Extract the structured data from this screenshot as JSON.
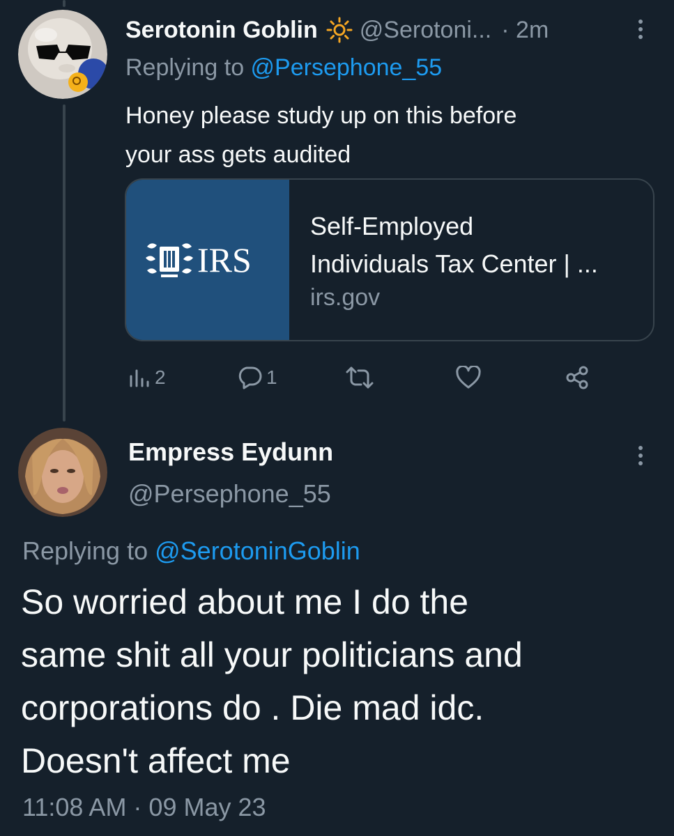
{
  "reply_tweet": {
    "display_name": "Serotonin Goblin",
    "badge_icon": "sun-icon",
    "handle": "@Serotoni...",
    "separator": "·",
    "time": "2m",
    "replying_prefix": "Replying to ",
    "replying_mention": "@Persephone_55",
    "text": "Honey please study up on this before\nyour ass gets audited",
    "link_card": {
      "thumbnail_text": "IRS",
      "title": "Self-Employed\nIndividuals Tax Center | ...",
      "domain": "irs.gov"
    },
    "actions": {
      "views_icon": "bar-chart-icon",
      "views_count": "2",
      "reply_icon": "comment-icon",
      "reply_count": "1",
      "retweet_icon": "retweet-icon",
      "like_icon": "heart-icon",
      "share_icon": "share-icon"
    }
  },
  "main_tweet": {
    "display_name": "Empress Eydunn",
    "handle": "@Persephone_55",
    "replying_prefix": "Replying to ",
    "replying_mention": "@SerotoninGoblin",
    "text": "So worried about me I do the\nsame shit all your politicians and\ncorporations do . Die mad idc.\nDoesn't affect me",
    "timestamp": "11:08 AM · 09 May 23"
  },
  "colors": {
    "background": "#15202b",
    "text_primary": "#f7f9f9",
    "text_secondary": "#8b98a5",
    "accent": "#1d9bf0",
    "border": "#38444d",
    "badge": "#f5a623",
    "irs_blue": "#20507c"
  }
}
